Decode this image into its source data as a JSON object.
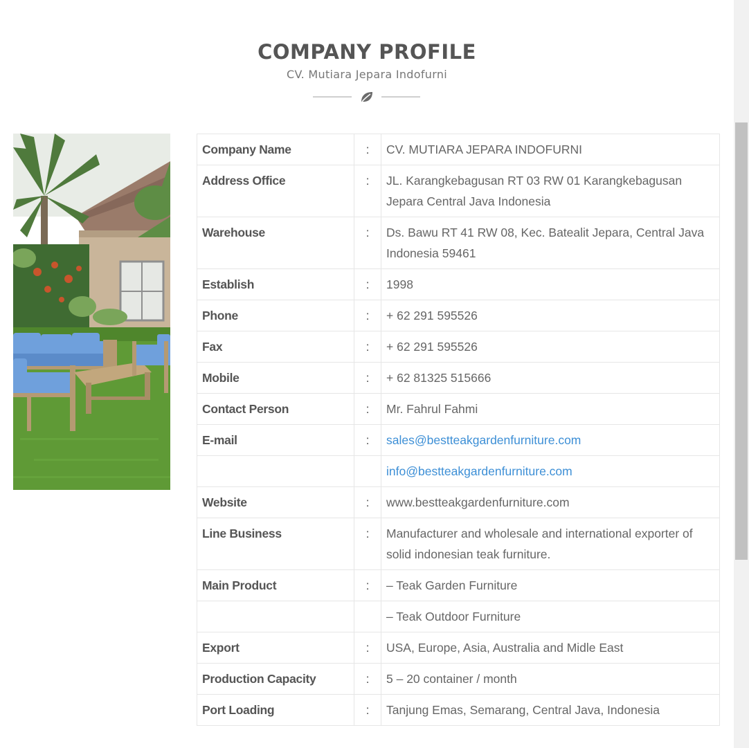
{
  "header": {
    "title": "COMPANY PROFILE",
    "subtitle": "CV. Mutiara Jepara Indofurni"
  },
  "image": {
    "subject": "teak garden sofa set with blue cushions on lawn"
  },
  "colors": {
    "link": "#3d8fd6",
    "text": "#555555",
    "border": "#e6e6e6"
  },
  "rows": [
    {
      "label": "Company Name",
      "colon": ":",
      "value": "CV. MUTIARA JEPARA INDOFURNI"
    },
    {
      "label": "Address Office",
      "colon": ":",
      "value": "JL. Karangkebagusan RT 03 RW 01 Karangkebagusan Jepara Central Java Indonesia"
    },
    {
      "label": "Warehouse",
      "colon": ":",
      "value": "Ds. Bawu RT 41 RW 08, Kec. Batealit Jepara, Central Java Indonesia 59461"
    },
    {
      "label": "Establish",
      "colon": ":",
      "value": "1998"
    },
    {
      "label": "Phone",
      "colon": ":",
      "value": "+ 62 291 595526"
    },
    {
      "label": "Fax",
      "colon": ":",
      "value": "+ 62 291 595526"
    },
    {
      "label": "Mobile",
      "colon": ":",
      "value": "+ 62 81325 515666"
    },
    {
      "label": "Contact Person",
      "colon": ":",
      "value": "Mr. Fahrul Fahmi"
    },
    {
      "label": "E-mail",
      "colon": ":",
      "value": "sales@bestteakgardenfurniture.com"
    },
    {
      "label": "",
      "colon": "",
      "value": "info@bestteakgardenfurniture.com"
    },
    {
      "label": "Website",
      "colon": ":",
      "value": "www.bestteakgardenfurniture.com"
    },
    {
      "label": "Line Business",
      "colon": ":",
      "value": "Manufacturer and wholesale and international exporter of solid indonesian teak furniture."
    },
    {
      "label": "Main Product",
      "colon": ":",
      "value": "– Teak Garden Furniture"
    },
    {
      "label": "",
      "colon": "",
      "value": "– Teak Outdoor Furniture"
    },
    {
      "label": "Export",
      "colon": ":",
      "value": "USA, Europe, Asia, Australia and Midle East"
    },
    {
      "label": "Production Capacity",
      "colon": ":",
      "value": "5 – 20 container / month"
    },
    {
      "label": "Port Loading",
      "colon": ":",
      "value": "Tanjung Emas, Semarang, Central Java, Indonesia"
    }
  ]
}
